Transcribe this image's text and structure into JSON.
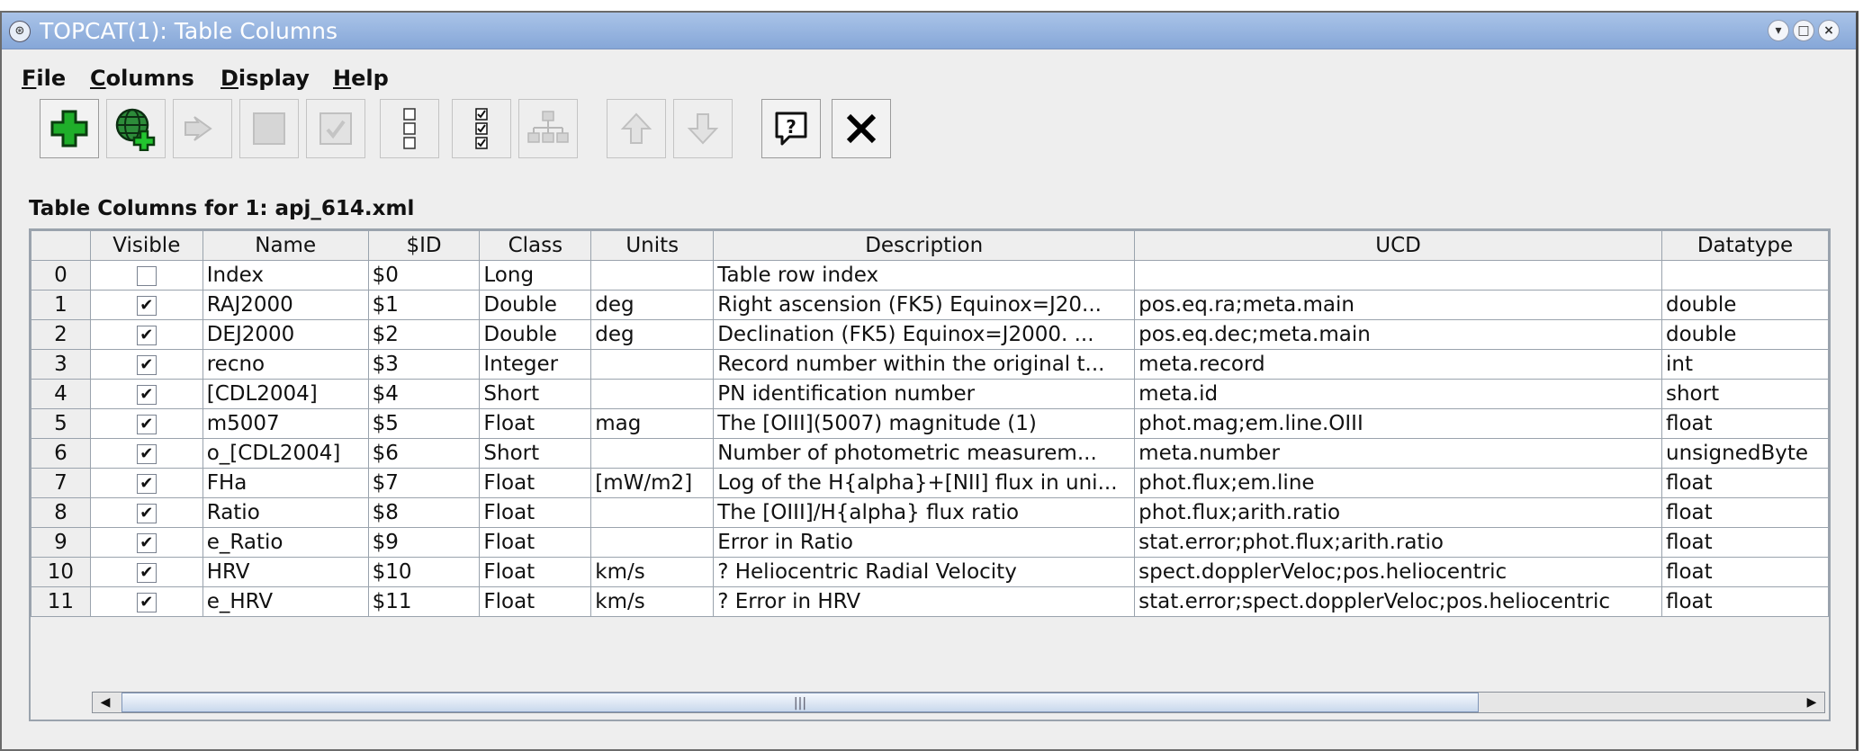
{
  "window": {
    "title": "TOPCAT(1): Table Columns"
  },
  "menu": [
    {
      "label": "File"
    },
    {
      "label": "Columns"
    },
    {
      "label": "Display"
    },
    {
      "label": "Help"
    }
  ],
  "toolbar": {
    "buttons": [
      {
        "name": "add-column-button",
        "icon": "green-plus-icon",
        "enabled": true
      },
      {
        "name": "add-sky-column-button",
        "icon": "globe-plus-icon",
        "enabled": true
      },
      {
        "name": "replace-column-button",
        "icon": "replace-arrow-icon",
        "enabled": false
      },
      {
        "name": "hide-column-button",
        "icon": "blank-box-icon",
        "enabled": false
      },
      {
        "name": "reveal-column-button",
        "icon": "check-box-icon",
        "enabled": false
      },
      {
        "name": "hide-all-button",
        "icon": "empty-checklist-icon",
        "enabled": true
      },
      {
        "name": "reveal-all-button",
        "icon": "checked-list-icon",
        "enabled": true
      },
      {
        "name": "column-hierarchy-button",
        "icon": "tree-icon",
        "enabled": false
      },
      {
        "name": "move-up-button",
        "icon": "up-arrow-icon",
        "enabled": false
      },
      {
        "name": "move-down-button",
        "icon": "down-arrow-icon",
        "enabled": false
      },
      {
        "name": "help-button",
        "icon": "help-bubble-icon",
        "enabled": true
      },
      {
        "name": "close-button",
        "icon": "close-x-icon",
        "enabled": true
      }
    ]
  },
  "heading": "Table Columns for 1: apj_614.xml",
  "table": {
    "headers": [
      "",
      "Visible",
      "Name",
      "$ID",
      "Class",
      "Units",
      "Description",
      "UCD",
      "Datatype"
    ],
    "rows": [
      {
        "index": "0",
        "visible": false,
        "name": "Index",
        "id": "$0",
        "class": "Long",
        "units": "",
        "description": "Table row index",
        "ucd": "",
        "datatype": ""
      },
      {
        "index": "1",
        "visible": true,
        "name": "RAJ2000",
        "id": "$1",
        "class": "Double",
        "units": "deg",
        "description": "Right ascension (FK5) Equinox=J20...",
        "ucd": "pos.eq.ra;meta.main",
        "datatype": "double"
      },
      {
        "index": "2",
        "visible": true,
        "name": "DEJ2000",
        "id": "$2",
        "class": "Double",
        "units": "deg",
        "description": "Declination (FK5) Equinox=J2000. ...",
        "ucd": "pos.eq.dec;meta.main",
        "datatype": "double"
      },
      {
        "index": "3",
        "visible": true,
        "name": "recno",
        "id": "$3",
        "class": "Integer",
        "units": "",
        "description": "Record number within the original t...",
        "ucd": "meta.record",
        "datatype": "int"
      },
      {
        "index": "4",
        "visible": true,
        "name": "[CDL2004]",
        "id": "$4",
        "class": "Short",
        "units": "",
        "description": "PN identification number",
        "ucd": "meta.id",
        "datatype": "short"
      },
      {
        "index": "5",
        "visible": true,
        "name": "m5007",
        "id": "$5",
        "class": "Float",
        "units": "mag",
        "description": "The [OIII](5007) magnitude (1)",
        "ucd": "phot.mag;em.line.OIII",
        "datatype": "float"
      },
      {
        "index": "6",
        "visible": true,
        "name": "o_[CDL2004]",
        "id": "$6",
        "class": "Short",
        "units": "",
        "description": "Number of photometric measurem...",
        "ucd": "meta.number",
        "datatype": "unsignedByte"
      },
      {
        "index": "7",
        "visible": true,
        "name": "FHa",
        "id": "$7",
        "class": "Float",
        "units": "[mW/m2]",
        "description": "Log of the H{alpha}+[NII] flux in uni...",
        "ucd": "phot.flux;em.line",
        "datatype": "float"
      },
      {
        "index": "8",
        "visible": true,
        "name": "Ratio",
        "id": "$8",
        "class": "Float",
        "units": "",
        "description": "The [OIII]/H{alpha} flux ratio",
        "ucd": "phot.flux;arith.ratio",
        "datatype": "float"
      },
      {
        "index": "9",
        "visible": true,
        "name": "e_Ratio",
        "id": "$9",
        "class": "Float",
        "units": "",
        "description": "Error in Ratio",
        "ucd": "stat.error;phot.flux;arith.ratio",
        "datatype": "float"
      },
      {
        "index": "10",
        "visible": true,
        "name": "HRV",
        "id": "$10",
        "class": "Float",
        "units": "km/s",
        "description": "? Heliocentric Radial Velocity",
        "ucd": "spect.dopplerVeloc;pos.heliocentric",
        "datatype": "float"
      },
      {
        "index": "11",
        "visible": true,
        "name": "e_HRV",
        "id": "$11",
        "class": "Float",
        "units": "km/s",
        "description": "? Error in HRV",
        "ucd": "stat.error;spect.dopplerVeloc;pos.heliocentric",
        "datatype": "float"
      }
    ]
  },
  "scrollbar": {
    "position_fraction": 0.0,
    "visible_fraction": 0.79
  },
  "colors": {
    "titlebar": "#93b1dd",
    "window_bg": "#eeeeee",
    "grid": "#9aa3ad",
    "add_green": "#1fae2a"
  }
}
